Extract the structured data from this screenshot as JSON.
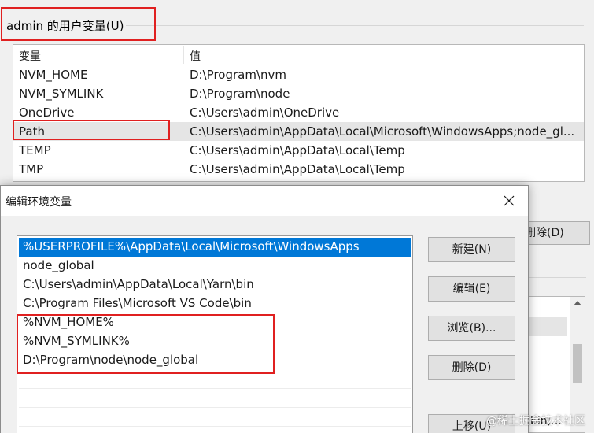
{
  "env_window": {
    "user_vars_group_label": "admin 的用户变量(U)",
    "columns": {
      "name": "变量",
      "value": "值"
    },
    "user_vars": [
      {
        "name": "NVM_HOME",
        "value": "D:\\Program\\nvm"
      },
      {
        "name": "NVM_SYMLINK",
        "value": "D:\\Program\\node"
      },
      {
        "name": "OneDrive",
        "value": "C:\\Users\\admin\\OneDrive"
      },
      {
        "name": "Path",
        "value": "C:\\Users\\admin\\AppData\\Local\\Microsoft\\WindowsApps;node_gl..."
      },
      {
        "name": "TEMP",
        "value": "C:\\Users\\admin\\AppData\\Local\\Temp"
      },
      {
        "name": "TMP",
        "value": "C:\\Users\\admin\\AppData\\Local\\Temp"
      }
    ],
    "selected_var": "Path",
    "delete_button_partial": "删除(D)",
    "partial_bottom_text": "bin;..."
  },
  "edit_dialog": {
    "title": "编辑环境变量",
    "path_entries": [
      "%USERPROFILE%\\AppData\\Local\\Microsoft\\WindowsApps",
      "node_global",
      "C:\\Users\\admin\\AppData\\Local\\Yarn\\bin",
      "C:\\Program Files\\Microsoft VS Code\\bin",
      "%NVM_HOME%",
      "%NVM_SYMLINK%",
      "D:\\Program\\node\\node_global"
    ],
    "selected_entry_index": 0,
    "buttons": {
      "new": "新建(N)",
      "edit": "编辑(E)",
      "browse": "浏览(B)...",
      "delete": "删除(D)",
      "move_up": "上移(U)"
    }
  },
  "watermark": "@稀土掘金技术社区",
  "colors": {
    "highlight_box": "#e02020",
    "selection_blue": "#0078d7",
    "row_selected_gray": "#e5e5e5",
    "window_bg": "#f0f0f0"
  },
  "icons": {
    "close": "close-icon"
  }
}
